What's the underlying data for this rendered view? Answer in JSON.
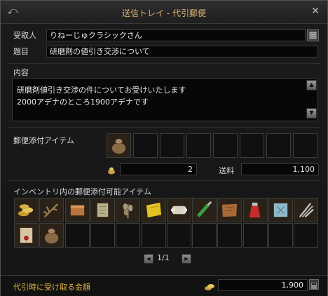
{
  "window": {
    "title": "送信トレイ - 代引郵便",
    "back_icon": "back-arrow-icon",
    "close_icon": "close-icon"
  },
  "recipient": {
    "label": "受取人",
    "value": "りねーじゅクラシックさん",
    "button_icon": "address-book-icon"
  },
  "subject": {
    "label": "題目",
    "value": "研磨剤の値引き交渉について"
  },
  "body": {
    "label": "内容",
    "lines": [
      "研磨剤値引き交渉の件についてお受けいたします",
      "2000アデナのところ1900アデナです"
    ]
  },
  "attach": {
    "label": "郵便添付アイテム",
    "slots": [
      "coin-pouch",
      "",
      "",
      "",
      "",
      "",
      "",
      ""
    ],
    "adena_value": "2",
    "postage_label": "送料",
    "postage_value": "1,100"
  },
  "inventory": {
    "label": "インベントリ内の郵便添付可能アイテム",
    "items": [
      "gold-coins",
      "dry-branch",
      "oil-box",
      "scroll",
      "wheat",
      "yellow-cloth",
      "bone-scroll",
      "green-potion",
      "leather",
      "red-potion",
      "crystal-map",
      "silver-feathers",
      "seal-scroll",
      "coin-pouch"
    ],
    "page": "1/1"
  },
  "footer": {
    "label": "代引時に受け取る金額",
    "amount": "1,900"
  },
  "colors": {
    "gold": "#d7b070",
    "footer_label": "#e0b440"
  }
}
